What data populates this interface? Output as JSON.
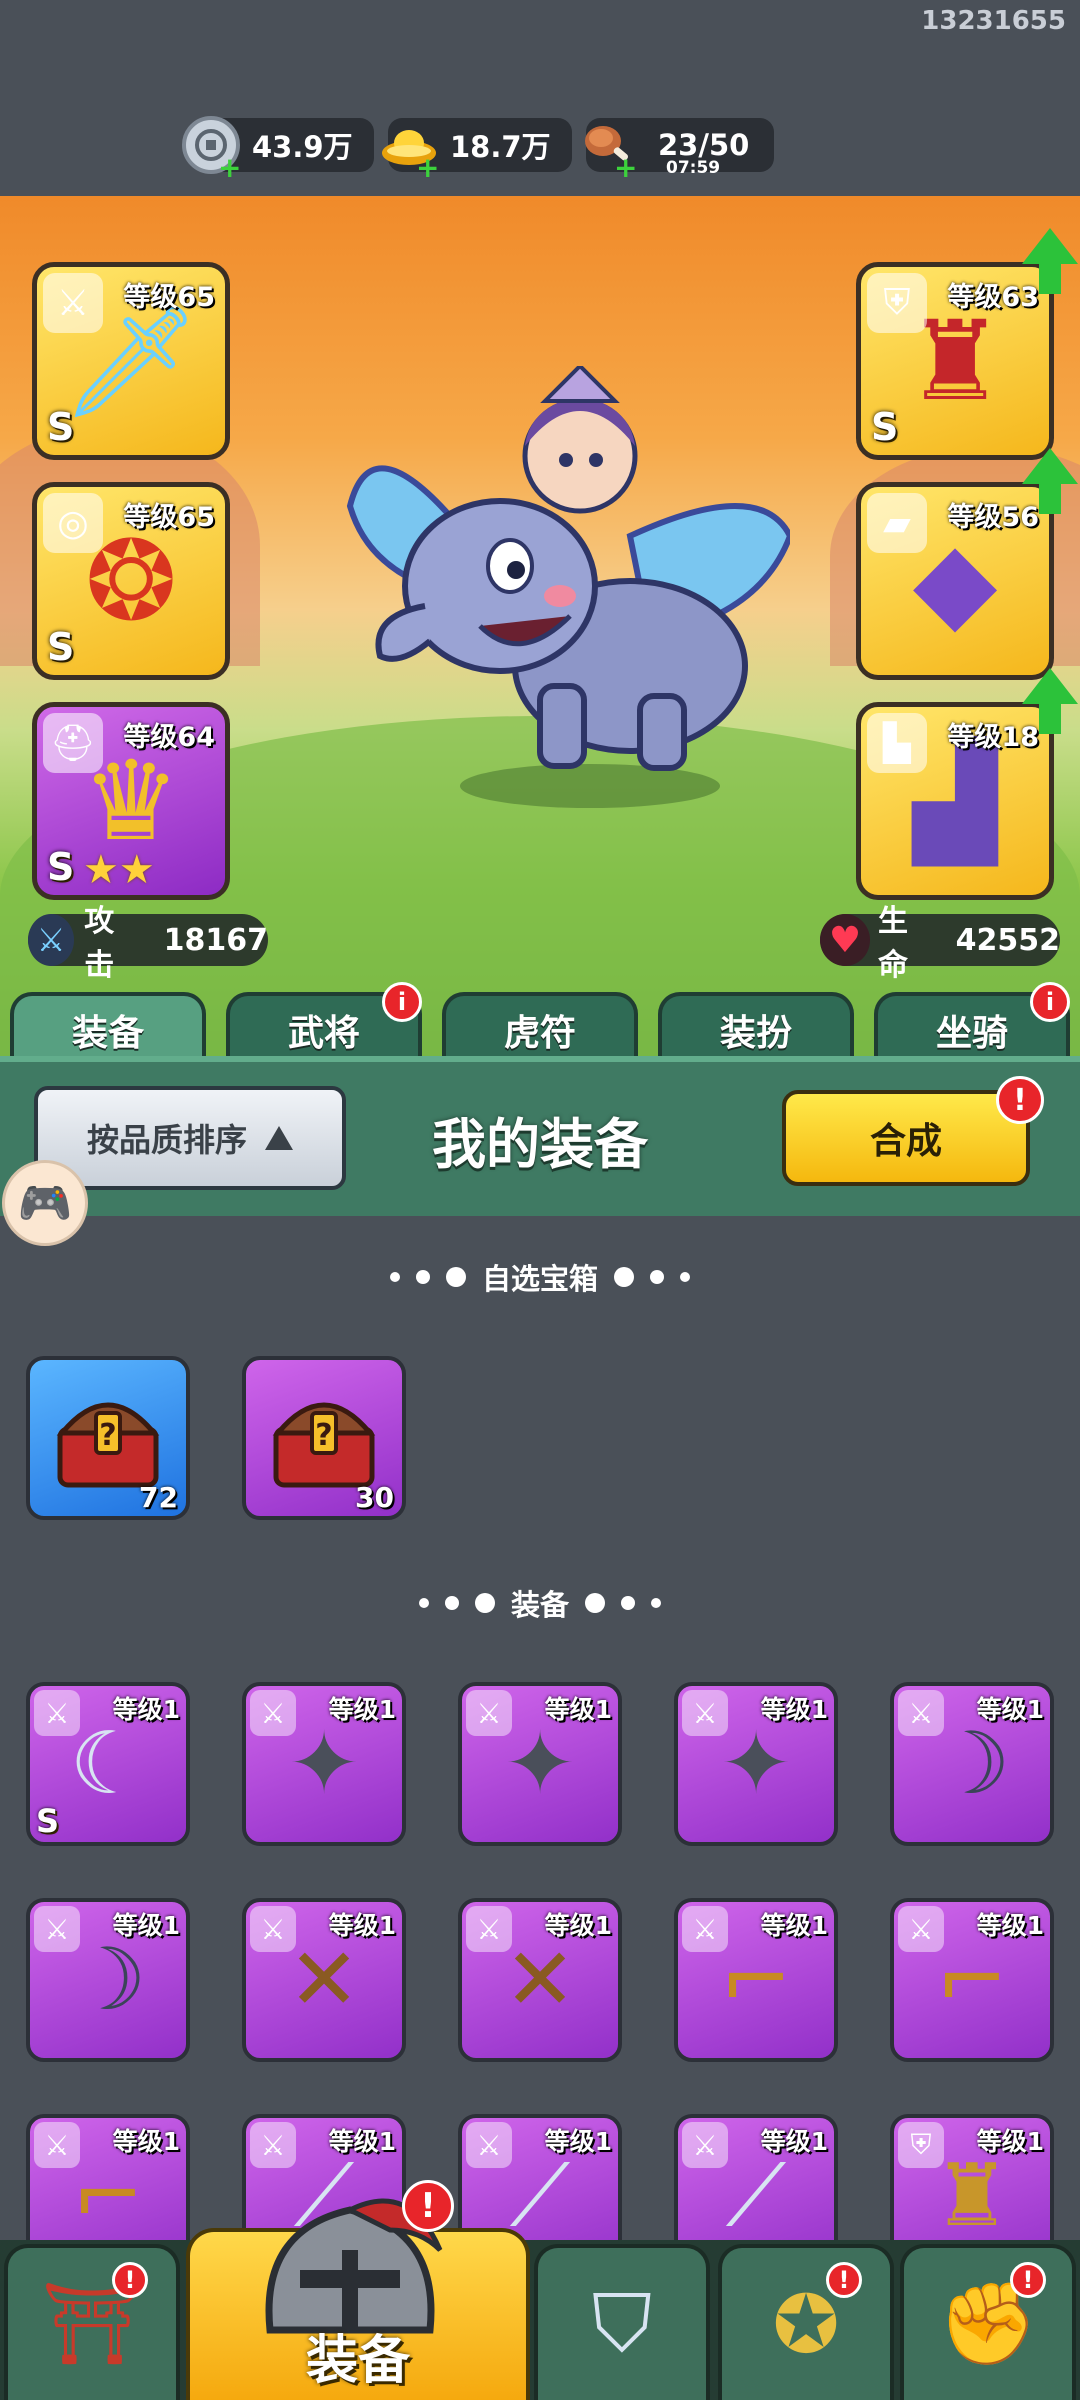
{
  "user_id": "13231655",
  "resources": {
    "silver": {
      "icon": "silver-coin-icon",
      "value": "43.9万"
    },
    "gold": {
      "icon": "gold-ingot-icon",
      "value": "18.7万"
    },
    "stamina": {
      "icon": "meat-icon",
      "value": "23/50",
      "timer": "07:59"
    },
    "plus": "+"
  },
  "equipped": {
    "left": [
      {
        "slot": "weapon",
        "icon": "sword-icon",
        "level": "等级65",
        "grade": "S",
        "art": "ice-sword-icon"
      },
      {
        "slot": "amulet",
        "icon": "medal-icon",
        "level": "等级65",
        "grade": "S",
        "art": "ruby-amulet-icon"
      },
      {
        "slot": "helmet",
        "icon": "helmet-icon",
        "level": "等级64",
        "grade": "S",
        "art": "golden-helmet-icon",
        "stars": 2
      }
    ],
    "right": [
      {
        "slot": "armor",
        "icon": "armor-icon",
        "level": "等级63",
        "grade": "S",
        "art": "red-armor-icon",
        "upgrade": true
      },
      {
        "slot": "bracer",
        "icon": "bracer-icon",
        "level": "等级56",
        "art": "purple-bracer-icon",
        "upgrade": true
      },
      {
        "slot": "boots",
        "icon": "boot-icon",
        "level": "等级18",
        "art": "purple-boots-icon",
        "upgrade": true
      }
    ]
  },
  "stats": {
    "attack_label": "攻击",
    "attack_value": "18167",
    "hp_label": "生命",
    "hp_value": "42552"
  },
  "tabs": [
    {
      "label": "装备",
      "active": true,
      "badge": false
    },
    {
      "label": "武将",
      "active": false,
      "badge": true
    },
    {
      "label": "虎符",
      "active": false,
      "badge": false
    },
    {
      "label": "装扮",
      "active": false,
      "badge": false
    },
    {
      "label": "坐骑",
      "active": false,
      "badge": true
    }
  ],
  "badge_text": "i",
  "alert_text": "!",
  "header": {
    "sort_label": "按品质排序",
    "title": "我的装备",
    "merge_label": "合成"
  },
  "sections": {
    "chests": "自选宝箱",
    "equipment": "装备"
  },
  "chests": [
    {
      "color": "blue",
      "count": "72",
      "icon": "mystery-chest-icon"
    },
    {
      "color": "purple",
      "count": "30",
      "icon": "mystery-chest-icon"
    }
  ],
  "items": [
    {
      "level": "等级1",
      "grade": "S",
      "art": "ornate-scimitar-icon",
      "tag": "sword-icon"
    },
    {
      "level": "等级1",
      "art": "shuriken-icon",
      "tag": "sword-icon"
    },
    {
      "level": "等级1",
      "art": "shuriken-icon",
      "tag": "sword-icon"
    },
    {
      "level": "等级1",
      "art": "shuriken-icon",
      "tag": "sword-icon"
    },
    {
      "level": "等级1",
      "art": "curved-blade-icon",
      "tag": "sword-icon"
    },
    {
      "level": "等级1",
      "art": "curved-blade-icon",
      "tag": "sword-icon"
    },
    {
      "level": "等级1",
      "art": "crossbow-icon",
      "tag": "sword-icon"
    },
    {
      "level": "等级1",
      "art": "crossbow-icon",
      "tag": "sword-icon"
    },
    {
      "level": "等级1",
      "art": "golden-gun-icon",
      "tag": "sword-icon"
    },
    {
      "level": "等级1",
      "art": "golden-gun-icon",
      "tag": "sword-icon"
    },
    {
      "level": "等级1",
      "art": "golden-gun-icon",
      "tag": "sword-icon"
    },
    {
      "level": "等级1",
      "art": "glaive-icon",
      "tag": "sword-icon"
    },
    {
      "level": "等级1",
      "art": "glaive-icon",
      "tag": "sword-icon"
    },
    {
      "level": "等级1",
      "art": "glaive-icon",
      "tag": "sword-icon"
    },
    {
      "level": "等级1",
      "art": "golden-armor-icon",
      "tag": "armor-icon"
    }
  ],
  "nav": {
    "items": [
      {
        "icon": "fortress-gate-icon",
        "badge": true
      },
      {
        "icon": "helmet-icon",
        "label": "装备",
        "active": true,
        "badge": true
      },
      {
        "icon": "shield-swords-icon",
        "badge": false
      },
      {
        "icon": "rooster-stars-icon",
        "badge": true
      },
      {
        "icon": "fist-arrow-icon",
        "badge": true
      }
    ]
  },
  "float_button_icon": "gamepad-icon",
  "colors": {
    "gold_rarity": "#f5b71c",
    "purple_rarity": "#9230c9",
    "blue_rarity": "#1f72e0",
    "panel_green": "#3f7a63",
    "alert_red": "#e8252a",
    "upgrade_green": "#2cc23a"
  }
}
